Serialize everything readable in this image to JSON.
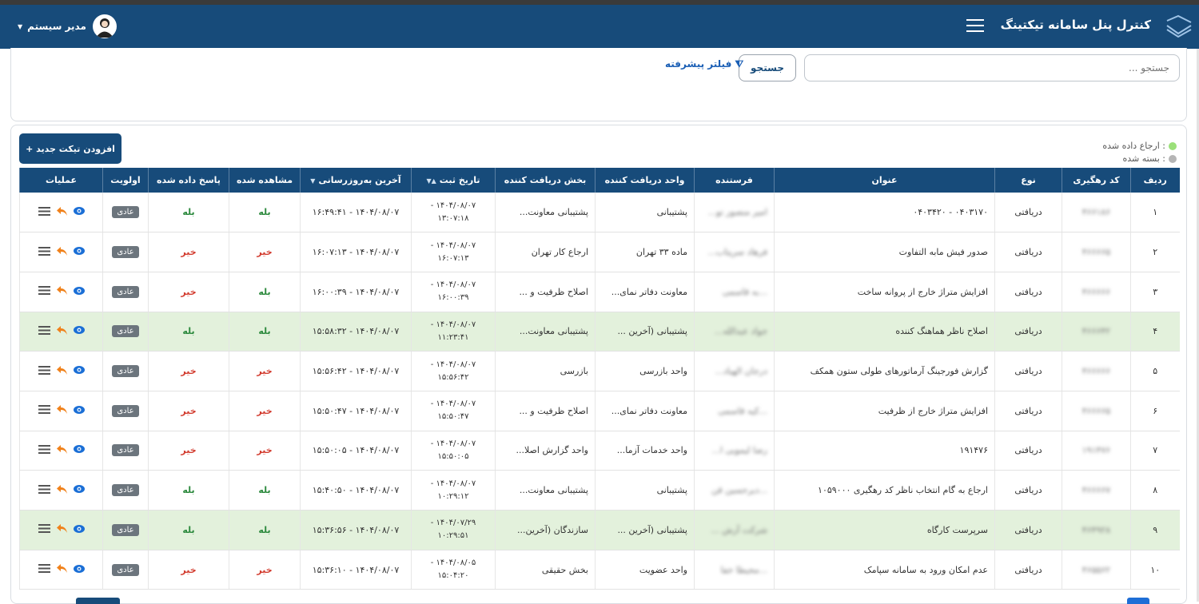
{
  "header": {
    "title": "کنترل پنل سامانه تیکتینگ",
    "user_name": "مدیر سیستم"
  },
  "search": {
    "placeholder": "جستجو ...",
    "button_label": "جستجو",
    "advanced_filter_label": "فیلتر پیشرفته"
  },
  "toolbar": {
    "add_ticket_label": "افزودن تیکت جدید"
  },
  "legend": {
    "referred": ": ارجاع داده شده",
    "closed": ": بسته شده",
    "referred_color": "#9be07a",
    "closed_color": "#b5b5b5"
  },
  "table": {
    "columns": [
      "ردیف",
      "کد رهگیری",
      "نوع",
      "عنوان",
      "فرستنده",
      "واحد دریافت کننده",
      "بخش دریافت کننده",
      "تاریخ ثبت",
      "آخرین به‌روزرسانی",
      "مشاهده شده",
      "پاسخ داده شده",
      "اولویت",
      "عملیات"
    ],
    "rows": [
      {
        "num": "۱",
        "code": "۴۶۶۱۸۶",
        "type": "دریافتی",
        "title": "۰۴۰۳۱۷۰ - ۰۴۰۳۴۲۰",
        "sender": "امیر منصور تو...",
        "unit": "پشتیبانی",
        "section": "پشتیبانی معاونت...",
        "reg_date": "۱۴۰۴/۰۸/۰۷ -",
        "reg_time": "۱۳:۰۷:۱۸",
        "updated": "۱۴۰۴/۰۸/۰۷ - ۱۶:۴۹:۴۱",
        "seen": "بله",
        "answered": "بله",
        "priority": "عادی",
        "highlight": false
      },
      {
        "num": "۲",
        "code": "۴۶۶۶۶۵",
        "type": "دریافتی",
        "title": "صدور فیش مابه التفاوت",
        "sender": "فرهاد سرپتاب...",
        "unit": "ماده ۳۳ تهران",
        "section": "ارجاع کار تهران",
        "reg_date": "۱۴۰۴/۰۸/۰۷ -",
        "reg_time": "۱۶:۰۷:۱۳",
        "updated": "۱۴۰۴/۰۸/۰۷ - ۱۶:۰۷:۱۳",
        "seen": "خیر",
        "answered": "خیر",
        "priority": "عادی",
        "highlight": false
      },
      {
        "num": "۳",
        "code": "۴۶۶۶۶۶",
        "type": "دریافتی",
        "title": "افزایش متراژ خارج از پروانه ساخت",
        "sender": "...به قاسمی",
        "unit": "معاونت دفاتر نمای...",
        "section": "اصلاح ظرفیت و ...",
        "reg_date": "۱۴۰۴/۰۸/۰۷ -",
        "reg_time": "۱۶:۰۰:۳۹",
        "updated": "۱۴۰۴/۰۸/۰۷ - ۱۶:۰۰:۳۹",
        "seen": "بله",
        "answered": "خیر",
        "priority": "عادی",
        "highlight": false
      },
      {
        "num": "۴",
        "code": "۴۶۶۶۴۲",
        "type": "دریافتی",
        "title": "اصلاح ناظر هماهنگ کننده",
        "sender": "جواد عبدالله...",
        "unit": "پشتیبانی (آخرین ...",
        "section": "پشتیبانی معاونت...",
        "reg_date": "۱۴۰۴/۰۸/۰۷ -",
        "reg_time": "۱۱:۲۳:۴۱",
        "updated": "۱۴۰۴/۰۸/۰۷ - ۱۵:۵۸:۳۲",
        "seen": "بله",
        "answered": "بله",
        "priority": "عادی",
        "highlight": true
      },
      {
        "num": "۵",
        "code": "۴۶۶۶۶۶",
        "type": "دریافتی",
        "title": "گزارش فورجینگ آرماتورهای طولی ستون همکف",
        "sender": "درجان الهیاد...",
        "unit": "واحد بازرسی",
        "section": "بازرسی",
        "reg_date": "۱۴۰۴/۰۸/۰۷ -",
        "reg_time": "۱۵:۵۶:۴۲",
        "updated": "۱۴۰۴/۰۸/۰۷ - ۱۵:۵۶:۴۲",
        "seen": "خیر",
        "answered": "خیر",
        "priority": "عادی",
        "highlight": false
      },
      {
        "num": "۶",
        "code": "۴۶۶۶۶۵",
        "type": "دریافتی",
        "title": "افزایش متراژ خارج از ظرفیت",
        "sender": "...کیه قاسمی",
        "unit": "معاونت دفاتر نمای...",
        "section": "اصلاح ظرفیت و ...",
        "reg_date": "۱۴۰۴/۰۸/۰۷ -",
        "reg_time": "۱۵:۵۰:۴۷",
        "updated": "۱۴۰۴/۰۸/۰۷ - ۱۵:۵۰:۴۷",
        "seen": "خیر",
        "answered": "خیر",
        "priority": "عادی",
        "highlight": false
      },
      {
        "num": "۷",
        "code": "۱۹۱۴۷۶",
        "type": "دریافتی",
        "title": "۱۹۱۴۷۶",
        "sender": "رضا لیمویی ا...",
        "unit": "واحد خدمات آزما...",
        "section": "واحد گزارش اصلا...",
        "reg_date": "۱۴۰۴/۰۸/۰۷ -",
        "reg_time": "۱۵:۵۰:۰۵",
        "updated": "۱۴۰۴/۰۸/۰۷ - ۱۵:۵۰:۰۵",
        "seen": "خیر",
        "answered": "خیر",
        "priority": "عادی",
        "highlight": false
      },
      {
        "num": "۸",
        "code": "۴۶۶۶۶۷",
        "type": "دریافتی",
        "title": "ارجاع به گام انتخاب ناظر کد رهگیری ۱۰۵۹۰۰۰",
        "sender": "...دیرحسین قن",
        "unit": "پشتیبانی",
        "section": "پشتیبانی معاونت...",
        "reg_date": "۱۴۰۴/۰۸/۰۷ -",
        "reg_time": "۱۰:۲۹:۱۲",
        "updated": "۱۴۰۴/۰۸/۰۷ - ۱۵:۴۰:۵۰",
        "seen": "بله",
        "answered": "بله",
        "priority": "عادی",
        "highlight": false
      },
      {
        "num": "۹",
        "code": "۴۶۴۹۲۸",
        "type": "دریافتی",
        "title": "سرپرست کارگاه",
        "sender": "شرکت آرش ...",
        "unit": "پشتیبانی (آخرین ...",
        "section": "سازندگان (آخرین...",
        "reg_date": "۱۴۰۴/۰۷/۲۹ -",
        "reg_time": "۱۰:۲۹:۵۱",
        "updated": "۱۴۰۴/۰۸/۰۷ - ۱۵:۳۶:۵۶",
        "seen": "بله",
        "answered": "بله",
        "priority": "عادی",
        "highlight": true
      },
      {
        "num": "۱۰",
        "code": "۴۶۵۵۶۲",
        "type": "دریافتی",
        "title": "عدم امکان ورود به سامانه سپامک",
        "sender": "...محیطا خفا",
        "unit": "واحد عضویت",
        "section": "بخش حقیقی",
        "reg_date": "۱۴۰۴/۰۸/۰۵ -",
        "reg_time": "۱۵:۰۴:۲۰",
        "updated": "۱۴۰۴/۰۸/۰۷ - ۱۵:۳۶:۱۰",
        "seen": "خیر",
        "answered": "خیر",
        "priority": "عادی",
        "highlight": false
      }
    ]
  }
}
